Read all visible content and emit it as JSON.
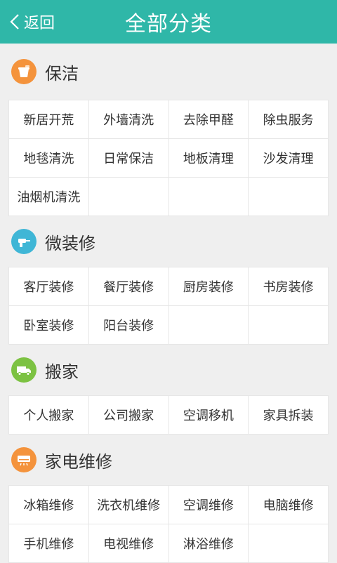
{
  "header": {
    "back_label": "返回",
    "title": "全部分类"
  },
  "colors": {
    "header": "#2fb7a8",
    "cleaning_icon": "#f4933c",
    "renovation_icon": "#3fb6d6",
    "moving_icon": "#7cc242",
    "appliance_icon": "#f4933c"
  },
  "sections": [
    {
      "title": "保洁",
      "icon": "bucket-icon",
      "items": [
        "新居开荒",
        "外墙清洗",
        "去除甲醛",
        "除虫服务",
        "地毯清洗",
        "日常保洁",
        "地板清理",
        "沙发清理",
        "油烟机清洗"
      ]
    },
    {
      "title": "微装修",
      "icon": "drill-icon",
      "items": [
        "客厅装修",
        "餐厅装修",
        "厨房装修",
        "书房装修",
        "卧室装修",
        "阳台装修"
      ]
    },
    {
      "title": "搬家",
      "icon": "truck-icon",
      "items": [
        "个人搬家",
        "公司搬家",
        "空调移机",
        "家具拆装"
      ]
    },
    {
      "title": "家电维修",
      "icon": "air-conditioner-icon",
      "items": [
        "冰箱维修",
        "洗衣机维修",
        "空调维修",
        "电脑维修",
        "手机维修",
        "电视维修",
        "淋浴维修"
      ]
    }
  ]
}
